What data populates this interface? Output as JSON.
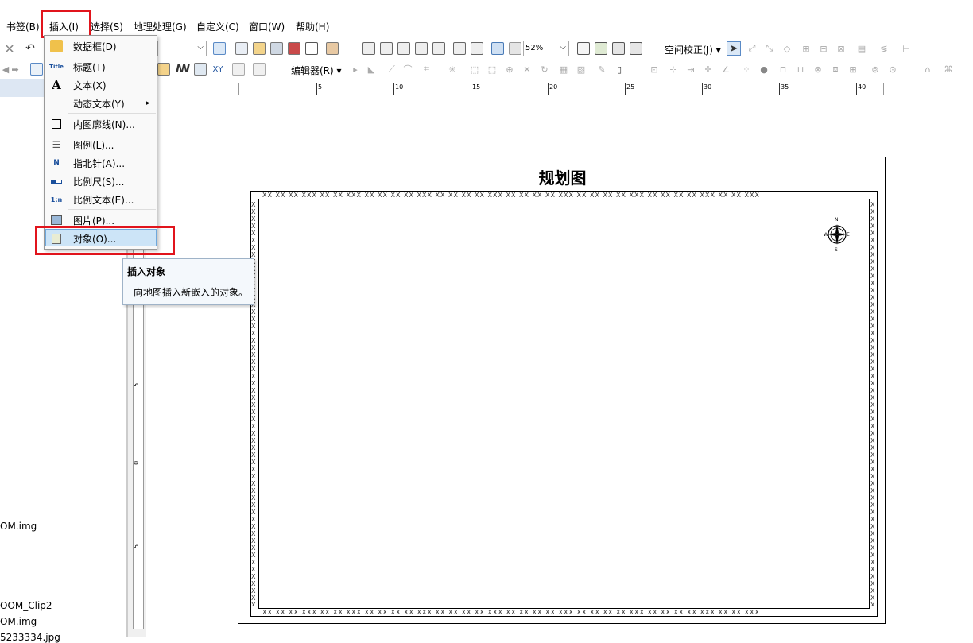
{
  "menubar": {
    "items": [
      "书签(B)",
      "插入(I)",
      "选择(S)",
      "地理处理(G)",
      "自定义(C)",
      "窗口(W)",
      "帮助(H)"
    ]
  },
  "toolbar": {
    "zoom": "52%",
    "georef_label": "空间校正(J) ▾",
    "editor_label": "编辑器(R) ▾"
  },
  "insert_menu": {
    "items": [
      {
        "label": "数据框(D)",
        "icon": "data-frame-icon"
      },
      {
        "label": "标题(T)",
        "icon": "title-icon",
        "icon_text": "Title"
      },
      {
        "label": "文本(X)",
        "icon": "text-icon",
        "icon_text": "A"
      },
      {
        "label": "动态文本(Y)",
        "icon": "none",
        "submenu": "▸"
      },
      {
        "label": "内图廓线(N)...",
        "icon": "neatline-icon"
      },
      {
        "label": "图例(L)...",
        "icon": "legend-icon"
      },
      {
        "label": "指北针(A)...",
        "icon": "north-arrow-icon",
        "icon_text": "N"
      },
      {
        "label": "比例尺(S)...",
        "icon": "scale-bar-icon"
      },
      {
        "label": "比例文本(E)...",
        "icon": "scale-text-icon",
        "icon_text": "1:n"
      },
      {
        "label": "图片(P)...",
        "icon": "picture-icon"
      },
      {
        "label": "对象(O)...",
        "icon": "object-icon"
      }
    ]
  },
  "tooltip": {
    "title": "插入对象",
    "description": "向地图插入新嵌入的对象。"
  },
  "left_panel": {
    "items": [
      "OM.img",
      "OOM_Clip2",
      "OM.img",
      "5233334.jpg"
    ]
  },
  "hruler": {
    "ticks": [
      "5",
      "10",
      "15",
      "20",
      "25",
      "30",
      "35",
      "40"
    ]
  },
  "vruler": {
    "ticks": [
      "15",
      "10",
      "5"
    ]
  },
  "layout": {
    "map_title": "规划图",
    "compass": {
      "n": "N",
      "s": "S",
      "e": "E",
      "w": "W"
    }
  },
  "colors": {
    "highlight": "#e1141c",
    "menu_selected": "#cce4f7"
  }
}
